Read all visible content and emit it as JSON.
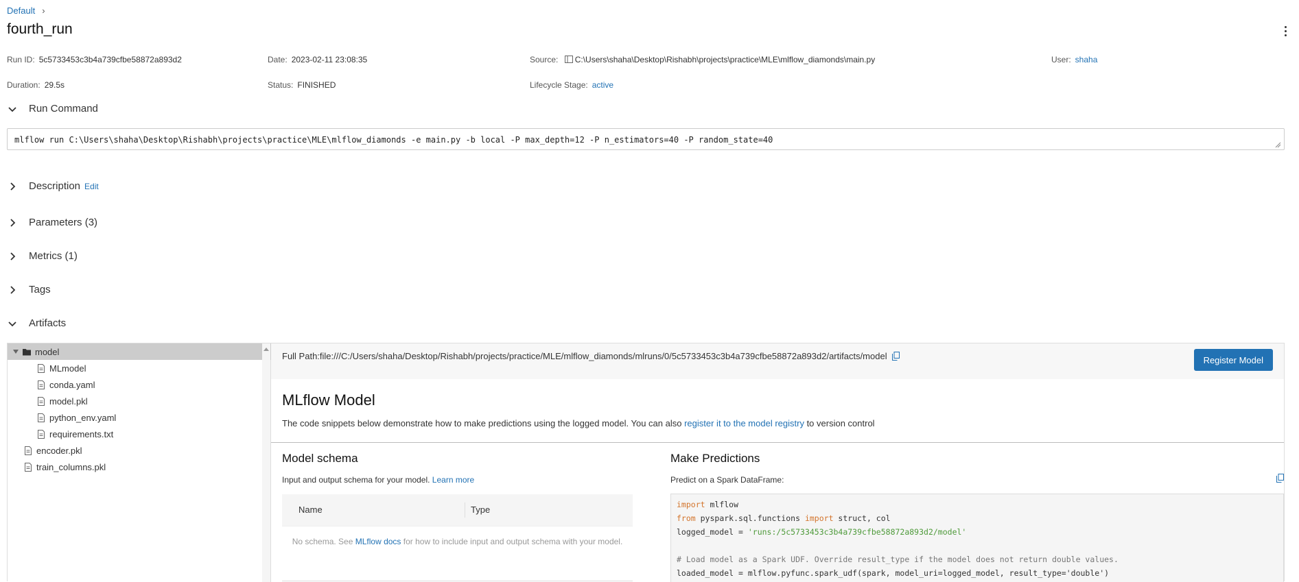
{
  "breadcrumb": {
    "parent": "Default",
    "separator": "›"
  },
  "run": {
    "title": "fourth_run",
    "run_id_label": "Run ID:",
    "run_id": "5c5733453c3b4a739cfbe58872a893d2",
    "date_label": "Date:",
    "date": "2023-02-11 23:08:35",
    "source_label": "Source:",
    "source": "C:\\Users\\shaha\\Desktop\\Rishabh\\projects\\practice\\MLE\\mlflow_diamonds\\main.py",
    "user_label": "User:",
    "user": "shaha",
    "duration_label": "Duration:",
    "duration": "29.5s",
    "status_label": "Status:",
    "status": "FINISHED",
    "lifecycle_label": "Lifecycle Stage:",
    "lifecycle": "active"
  },
  "sections": {
    "run_command": "Run Command",
    "description": "Description",
    "description_edit": "Edit",
    "parameters": "Parameters (3)",
    "metrics": "Metrics (1)",
    "tags": "Tags",
    "artifacts": "Artifacts"
  },
  "run_command_text": "mlflow run C:\\Users\\shaha\\Desktop\\Rishabh\\projects\\practice\\MLE\\mlflow_diamonds -e main.py -b local -P max_depth=12 -P n_estimators=40 -P random_state=40",
  "tree": [
    {
      "label": "model",
      "type": "folder",
      "selected": true
    },
    {
      "label": "MLmodel",
      "type": "file"
    },
    {
      "label": "conda.yaml",
      "type": "file"
    },
    {
      "label": "model.pkl",
      "type": "file"
    },
    {
      "label": "python_env.yaml",
      "type": "file"
    },
    {
      "label": "requirements.txt",
      "type": "file"
    },
    {
      "label": "encoder.pkl",
      "type": "file"
    },
    {
      "label": "train_columns.pkl",
      "type": "file"
    }
  ],
  "artifact_panel": {
    "full_path": "Full Path:file:///C:/Users/shaha/Desktop/Rishabh/projects/practice/MLE/mlflow_diamonds/mlruns/0/5c5733453c3b4a739cfbe58872a893d2/artifacts/model",
    "register_button": "Register Model",
    "heading": "MLflow Model",
    "desc_before": "The code snippets below demonstrate how to make predictions using the logged model. You can also ",
    "desc_link": "register it to the model registry",
    "desc_after": " to version control",
    "schema_title": "Model schema",
    "schema_sub": "Input and output schema for your model. ",
    "schema_learn": "Learn more",
    "schema_col_name": "Name",
    "schema_col_type": "Type",
    "schema_empty_before": "No schema. See ",
    "schema_empty_link": "MLflow docs",
    "schema_empty_after": " for how to include input and output schema with your model.",
    "predict_title": "Make Predictions",
    "predict_sub": "Predict on a Spark DataFrame:",
    "code": {
      "l1_kw": "import",
      "l1_rest": " mlflow",
      "l2_kw1": "from",
      "l2_mid": " pyspark.sql.functions ",
      "l2_kw2": "import",
      "l2_rest": " struct, col",
      "l3_pre": "logged_model = ",
      "l3_str": "'runs:/5c5733453c3b4a739cfbe58872a893d2/model'",
      "l5_cmt": "# Load model as a Spark UDF. Override result_type if the model does not return double values.",
      "l6": "loaded_model = mlflow.pyfunc.spark_udf(spark, model_uri=logged_model, result_type='double')"
    }
  },
  "colors": {
    "link": "#2272b4",
    "selected_row": "#cccccc",
    "button": "#2272b4"
  }
}
